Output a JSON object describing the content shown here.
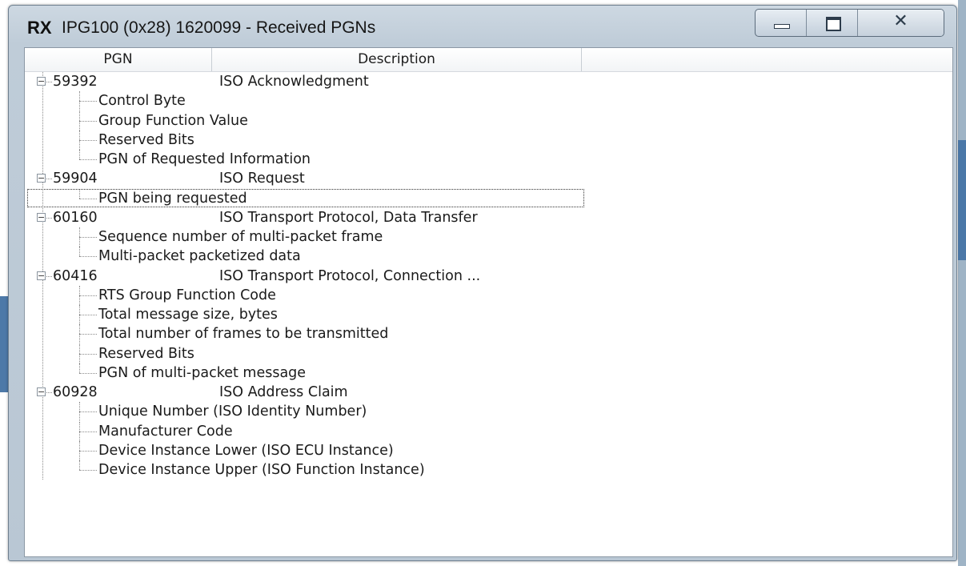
{
  "window": {
    "app_badge": "RX",
    "title": "IPG100 (0x28) 1620099 - Received PGNs"
  },
  "columns": {
    "pgn": "PGN",
    "description": "Description"
  },
  "tree": [
    {
      "pgn": "59392",
      "description": "ISO Acknowledgment",
      "children": [
        "Control Byte",
        "Group Function Value",
        "Reserved Bits",
        "PGN of Requested Information"
      ]
    },
    {
      "pgn": "59904",
      "description": "ISO Request",
      "children": [
        "PGN being requested"
      ]
    },
    {
      "pgn": "60160",
      "description": "ISO Transport Protocol, Data Transfer",
      "children": [
        "Sequence number of multi-packet frame",
        "Multi-packet packetized data"
      ]
    },
    {
      "pgn": "60416",
      "description": "ISO Transport Protocol, Connection ...",
      "children": [
        "RTS Group Function Code",
        "Total message size, bytes",
        "Total number of frames to be transmitted",
        "Reserved Bits",
        "PGN of multi-packet message"
      ]
    },
    {
      "pgn": "60928",
      "description": "ISO Address Claim",
      "children": [
        "Unique Number (ISO Identity Number)",
        "Manufacturer Code",
        "Device Instance Lower (ISO ECU Instance)",
        "Device Instance Upper (ISO Function Instance)"
      ]
    }
  ],
  "selected_item": "PGN being requested",
  "icons": {
    "minimize": "minimize-icon",
    "maximize": "maximize-icon",
    "close": "close-icon",
    "expander": "collapse-icon"
  },
  "colors": {
    "frame": "#bfccd8",
    "background": "#ffffff"
  }
}
